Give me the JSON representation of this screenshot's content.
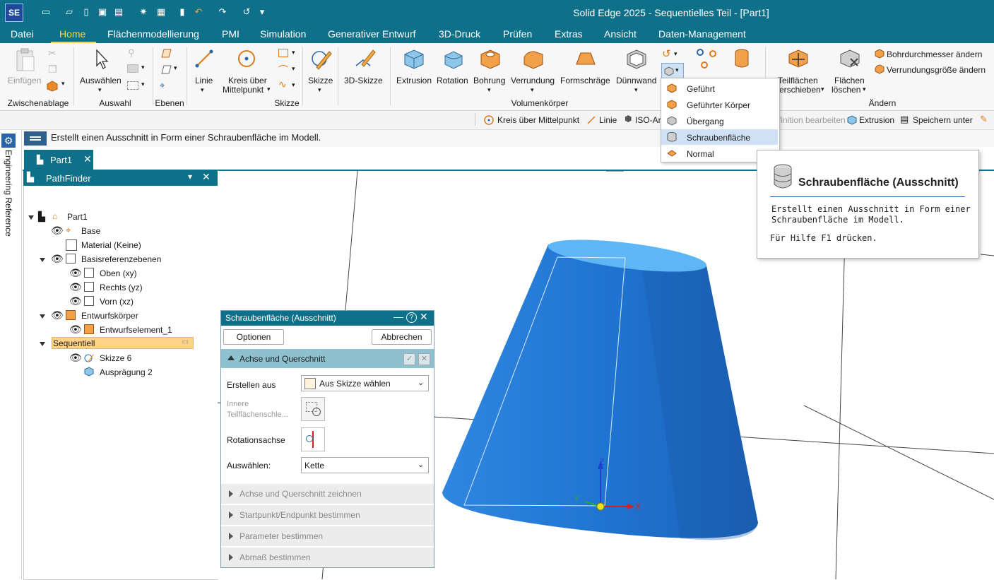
{
  "app": {
    "logo": "SE",
    "title": "Solid Edge 2025 - Sequentielles Teil - [Part1]"
  },
  "menu": {
    "tabs": [
      "Datei",
      "Home",
      "Flächenmodellierung",
      "PMI",
      "Simulation",
      "Generativer Entwurf",
      "3D-Druck",
      "Prüfen",
      "Extras",
      "Ansicht",
      "Daten-Management"
    ],
    "active": "Home"
  },
  "ribbon": {
    "paste": "Einfügen",
    "clipboard_group": "Zwischenablage",
    "select": "Auswählen",
    "select_group": "Auswahl",
    "planes_group": "Ebenen",
    "line": "Linie",
    "circle": "Kreis über",
    "circle2": "Mittelpunkt",
    "sketch": "Skizze",
    "sketch_group": "Skizze",
    "sketch3d": "3D-Skizze",
    "extrusion": "Extrusion",
    "rotation": "Rotation",
    "hole": "Bohrung",
    "round": "Verrundung",
    "draft": "Formschräge",
    "thinwall": "Dünnwand",
    "solids_group": "Volumenkörper",
    "move_faces": "Teilflächen",
    "move_faces2": "verschieben",
    "delete_faces": "Flächen",
    "delete_faces2": "löschen",
    "change_group": "Ändern",
    "hole_dia": "Bohrdurchmesser ändern",
    "round_size": "Verrundungsgröße ändern"
  },
  "quickbar": {
    "items": [
      "Kreis über Mittelpunkt",
      "Linie",
      "ISO-Ar",
      "finition bearbeiten",
      "Extrusion",
      "Speichern unter"
    ]
  },
  "prompt": {
    "text": "Erstellt einen Ausschnitt in Form einer Schraubenfläche im Modell."
  },
  "side": {
    "label": "Engineering Reference"
  },
  "doc_tab": {
    "label": "Part1"
  },
  "pathfinder": {
    "title": "PathFinder",
    "items": {
      "part": "Part1",
      "base": "Base",
      "material": "Material (Keine)",
      "refplanes": "Basisreferenzebenen",
      "top": "Oben (xy)",
      "right": "Rechts (yz)",
      "front": "Vorn (xz)",
      "bodies": "Entwurfskörper",
      "body1": "Entwurfselement_1",
      "sequential": "Sequentiell",
      "sketch": "Skizze 6",
      "extrude": "Ausprägung 2"
    }
  },
  "command": {
    "title": "Schraubenfläche (Ausschnitt)",
    "options": "Optionen",
    "cancel": "Abbrechen",
    "section": "Achse und Querschnitt",
    "create_from_label": "Erstellen aus",
    "create_from_value": "Aus Skizze wählen",
    "inner_label1": "Innere",
    "inner_label2": "Teilflächenschle...",
    "axis_label": "Rotationsachse",
    "select_label": "Auswählen:",
    "select_value": "Kette",
    "steps": [
      "Achse und Querschnitt zeichnen",
      "Startpunkt/Endpunkt bestimmen",
      "Parameter bestimmen",
      "Abmaß bestimmen"
    ]
  },
  "dropdown": {
    "items": [
      "Geführt",
      "Geführter Körper",
      "Übergang",
      "Schraubenfläche",
      "Normal"
    ],
    "highlighted": "Schraubenfläche"
  },
  "tooltip": {
    "title": "Schraubenfläche (Ausschnitt)",
    "line1": "Erstellt einen Ausschnitt in Form einer",
    "line2": "Schraubenfläche im Modell.",
    "help": "Für Hilfe F1 drücken."
  },
  "triad": {
    "x": "X",
    "y": "Y",
    "z": "Z"
  },
  "colors": {
    "title_bar": "#0f7089",
    "active_tab": "#ffd24a",
    "model_blue": "#1f7bd6",
    "menu_highlight": "#cfe1f5",
    "step_header": "#8ec1cf"
  }
}
